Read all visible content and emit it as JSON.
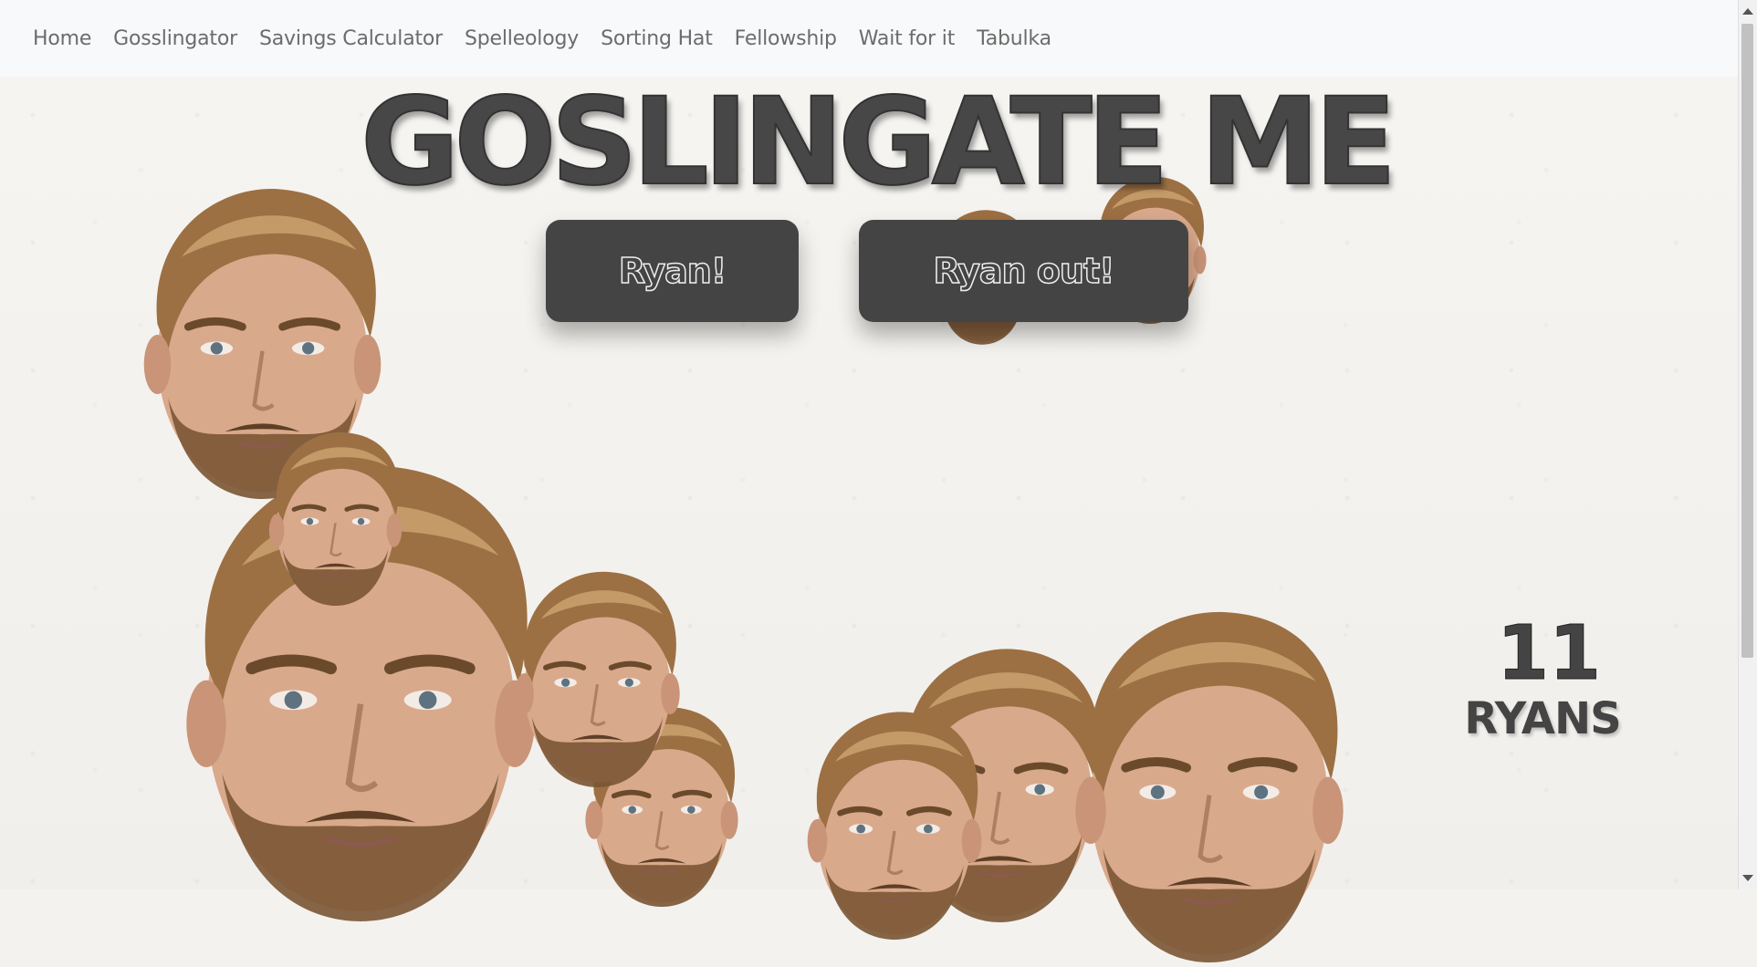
{
  "nav": {
    "items": [
      {
        "label": "Home"
      },
      {
        "label": "Gosslingator"
      },
      {
        "label": "Savings Calculator"
      },
      {
        "label": "Spelleology"
      },
      {
        "label": "Sorting Hat"
      },
      {
        "label": "Fellowship"
      },
      {
        "label": "Wait for it"
      },
      {
        "label": "Tabulka"
      }
    ]
  },
  "title": "GOSLINGATE ME",
  "buttons": {
    "add_label": "Ryan!",
    "remove_label": "Ryan out!"
  },
  "counter": {
    "count": "11",
    "label": "RYANS"
  },
  "colors": {
    "nav_bg": "#f8f9fa",
    "button_bg": "#444444",
    "text_dark": "#444444",
    "page_bg": "#f4f2ef"
  },
  "icons": [
    "ryan-face-image",
    "scroll-up-arrow",
    "scroll-down-arrow"
  ]
}
